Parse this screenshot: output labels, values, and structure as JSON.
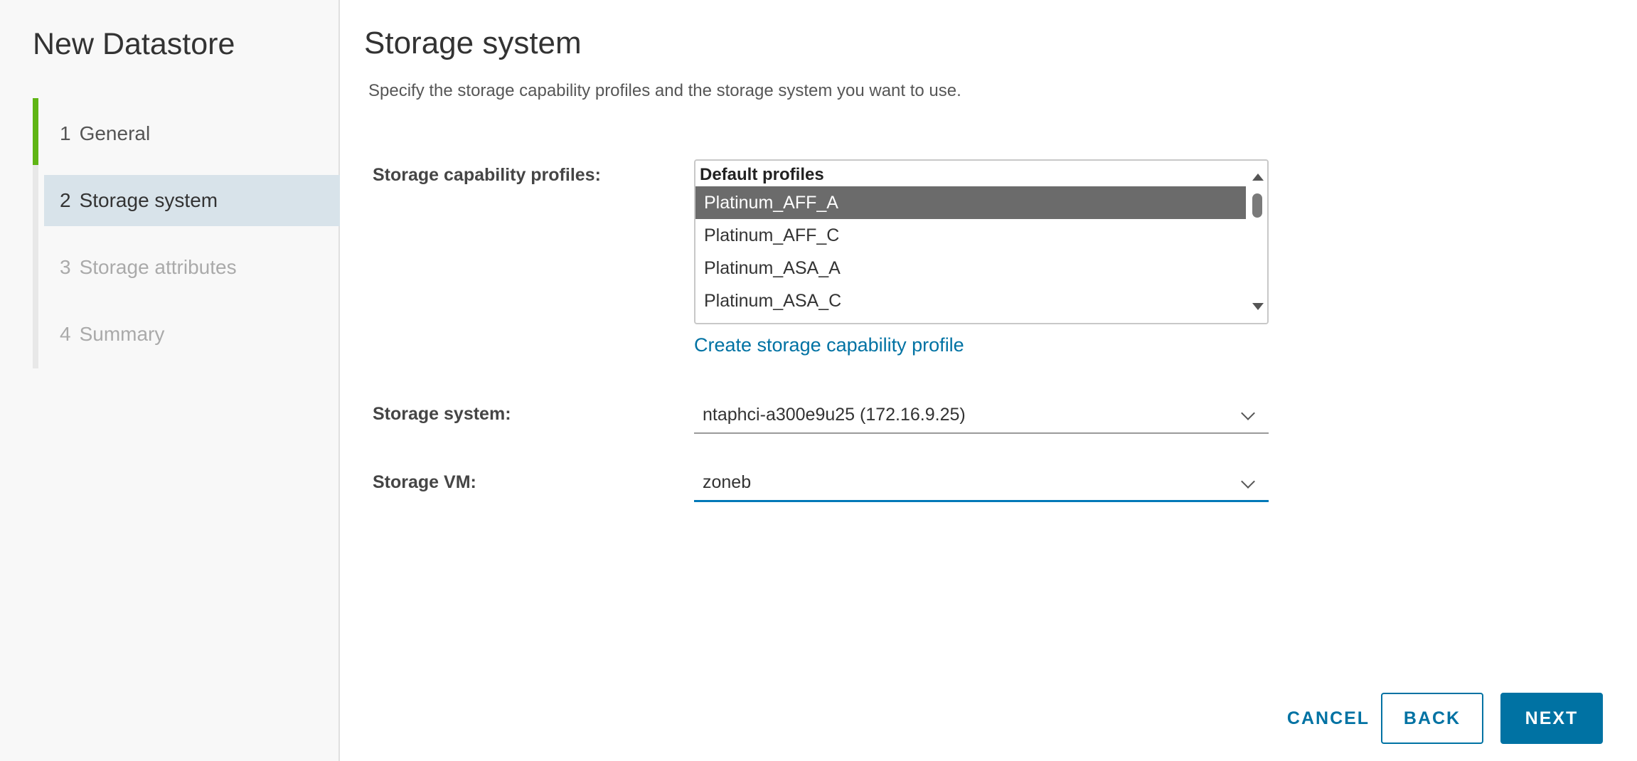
{
  "wizard": {
    "title": "New Datastore",
    "steps": [
      {
        "num": "1",
        "label": "General",
        "state": "done"
      },
      {
        "num": "2",
        "label": "Storage system",
        "state": "current"
      },
      {
        "num": "3",
        "label": "Storage attributes",
        "state": "todo"
      },
      {
        "num": "4",
        "label": "Summary",
        "state": "todo"
      }
    ]
  },
  "page": {
    "title": "Storage system",
    "description": "Specify the storage capability profiles and the storage system you want to use."
  },
  "form": {
    "profiles_label": "Storage capability profiles:",
    "profiles_group": "Default profiles",
    "profiles": [
      "Platinum_AFF_A",
      "Platinum_AFF_C",
      "Platinum_ASA_A",
      "Platinum_ASA_C"
    ],
    "selected_profile": "Platinum_AFF_A",
    "create_profile_link": "Create storage capability profile",
    "system_label": "Storage system:",
    "system_value": "ntaphci-a300e9u25 (172.16.9.25)",
    "vm_label": "Storage VM:",
    "vm_value": "zoneb"
  },
  "buttons": {
    "cancel": "CANCEL",
    "back": "BACK",
    "next": "NEXT"
  },
  "colors": {
    "accent": "#0072a3",
    "step_done": "#60b515",
    "current_step_bg": "#d8e3ea",
    "selected_option_bg": "#6b6b6b"
  },
  "icons": {
    "select_arrow": "chevron-down-icon",
    "scroll_up": "triangle-up-icon",
    "scroll_down": "triangle-down-icon"
  }
}
